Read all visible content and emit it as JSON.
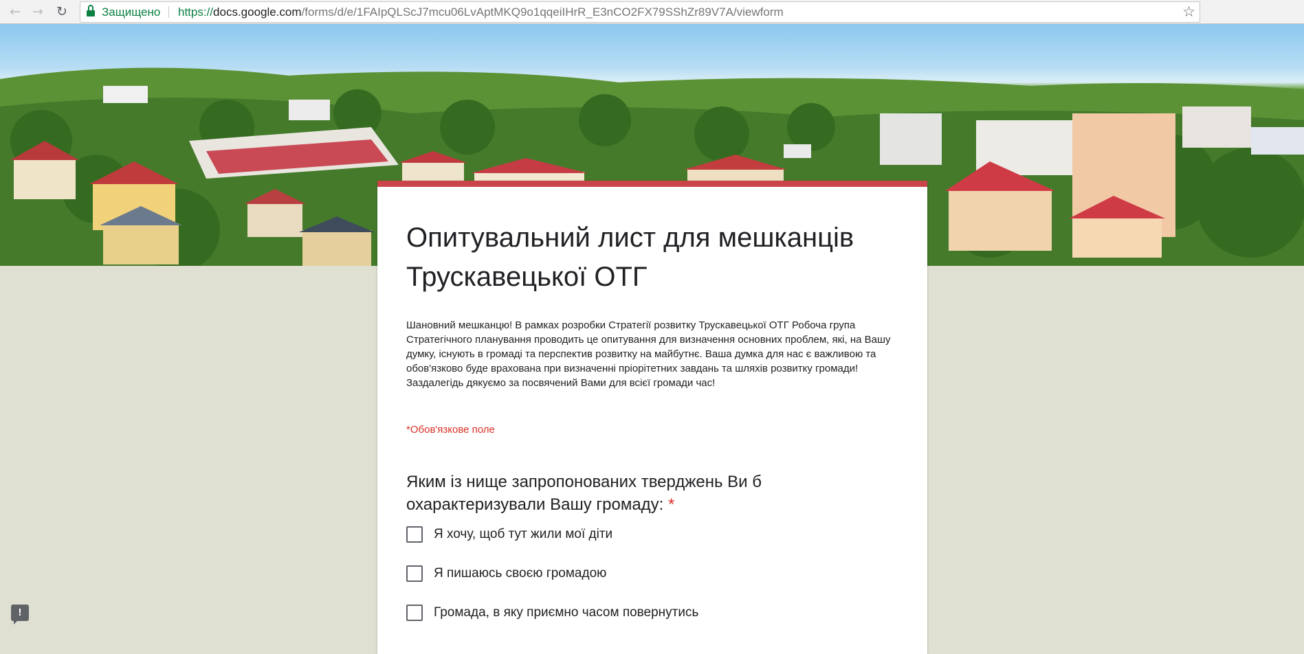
{
  "browser": {
    "back_icon": "arrow-left-icon",
    "forward_icon": "arrow-right-icon",
    "reload_icon": "reload-icon",
    "secure_label": "Защищено",
    "url_scheme": "https://",
    "url_host": "docs.google.com",
    "url_path": "/forms/d/e/1FAIpQLScJ7mcu06LvAptMKQ9o1qqeiIHrR_E3nCO2FX79SShZr89V7A/viewform",
    "bookmark_icon": "star-icon"
  },
  "form": {
    "accent_color": "#c9454a",
    "title": "Опитувальний лист для мешканців Трускавецької ОТГ",
    "description": "Шановний мешканцю! В рамках розробки Стратегії розвитку Трускавецької ОТГ Робоча група Стратегічного планування проводить це опитування для визначення основних проблем, які, на Вашу думку, існують в громаді та перспектив розвитку на майбутнє. Ваша думка для нас є важливою та обов'язково буде врахована при визначенні пріорітетних завдань та шляхів розвитку громади! Заздалегідь дякуємо за посвячений Вами для всієї громади час!",
    "required_note": "*Обов'язкове поле",
    "question": {
      "text": "Яким із нище запропонованих тверджень Ви б охарактеризували Вашу громаду:",
      "required_mark": "*",
      "options": [
        "Я хочу, щоб тут жили мої діти",
        "Я пишаюсь своєю громадою",
        "Громада, в яку приємно часом повернутись"
      ]
    }
  },
  "feedback": {
    "icon": "report-issue-icon",
    "glyph": "!"
  }
}
